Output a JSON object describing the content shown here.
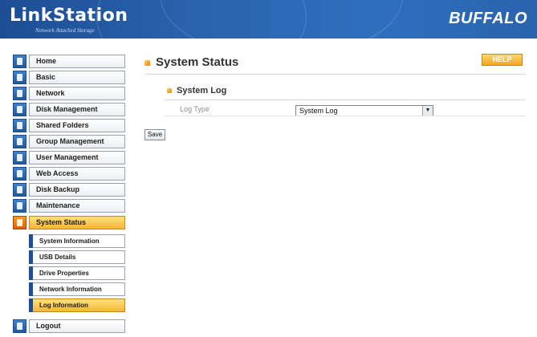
{
  "header": {
    "logo": "LinkStation",
    "logo_sub": "Network Attached Storage",
    "brand": "BUFFALO"
  },
  "sidebar": {
    "items": [
      {
        "label": "Home",
        "icon": "home-icon"
      },
      {
        "label": "Basic",
        "icon": "basic-icon"
      },
      {
        "label": "Network",
        "icon": "network-icon"
      },
      {
        "label": "Disk Management",
        "icon": "disk-icon"
      },
      {
        "label": "Shared Folders",
        "icon": "folder-icon"
      },
      {
        "label": "Group Management",
        "icon": "group-icon"
      },
      {
        "label": "User Management",
        "icon": "user-icon"
      },
      {
        "label": "Web Access",
        "icon": "web-icon"
      },
      {
        "label": "Disk Backup",
        "icon": "backup-icon"
      },
      {
        "label": "Maintenance",
        "icon": "maintenance-icon"
      },
      {
        "label": "System Status",
        "icon": "status-icon",
        "active": true
      },
      {
        "label": "Logout",
        "icon": "logout-icon"
      }
    ],
    "sub_items": [
      {
        "label": "System Information"
      },
      {
        "label": "USB Details"
      },
      {
        "label": "Drive Properties"
      },
      {
        "label": "Network Information"
      },
      {
        "label": "Log Information",
        "active": true
      }
    ]
  },
  "main": {
    "title": "System Status",
    "help_label": "HELP",
    "section_title": "System Log",
    "field_label": "Log Type",
    "log_type_value": "System Log",
    "save_label": "Save"
  },
  "colors": {
    "header": "#2a62ad",
    "accent": "#f2a623",
    "sub_bar": "#1f4f93"
  }
}
